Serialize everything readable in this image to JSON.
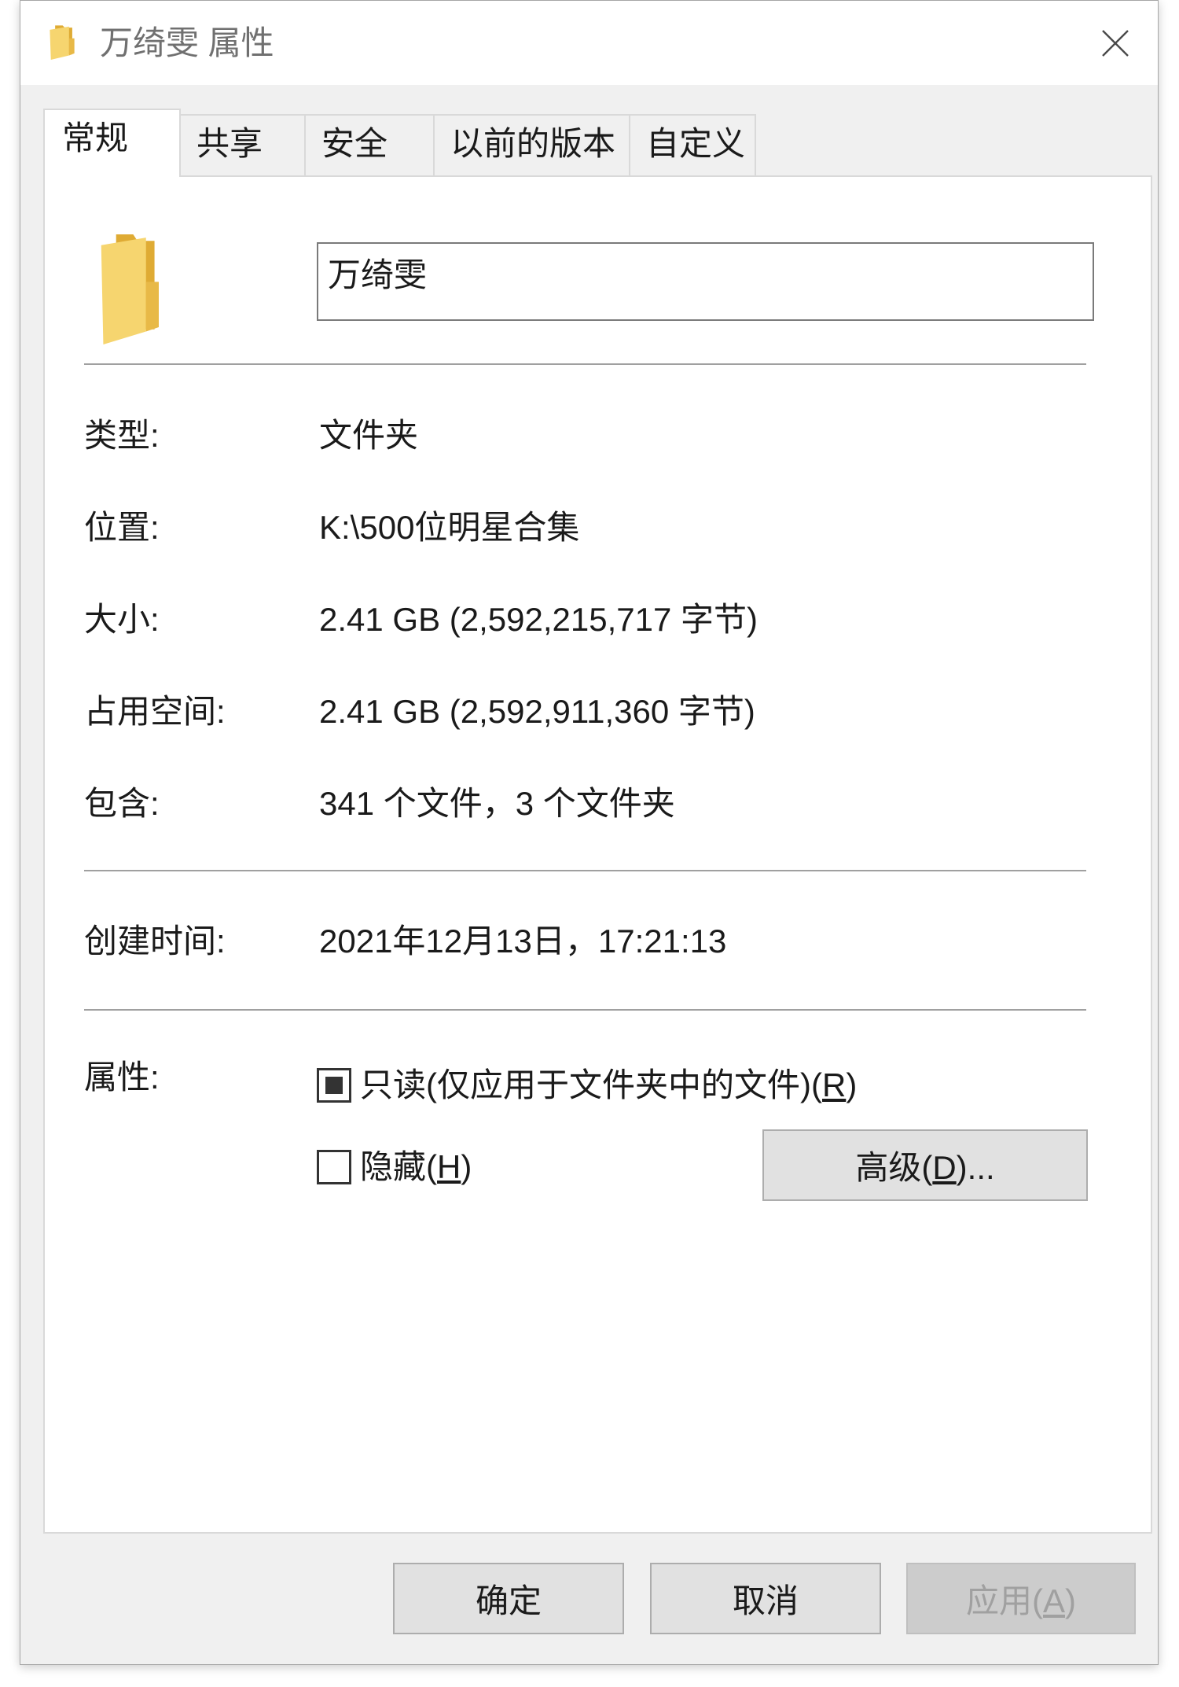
{
  "window": {
    "title": "万绮雯 属性",
    "icon": "folder-icon",
    "close_icon": "close-icon"
  },
  "tabs": [
    {
      "label": "常规",
      "selected": true
    },
    {
      "label": "共享",
      "selected": false
    },
    {
      "label": "安全",
      "selected": false
    },
    {
      "label": "以前的版本",
      "selected": false
    },
    {
      "label": "自定义",
      "selected": false
    }
  ],
  "general": {
    "icon": "folder-icon",
    "name": "万绮雯",
    "details": [
      {
        "label": "类型:",
        "value": "文件夹"
      },
      {
        "label": "位置:",
        "value": "K:\\500位明星合集"
      },
      {
        "label": "大小:",
        "value": "2.41 GB (2,592,215,717 字节)"
      },
      {
        "label": "占用空间:",
        "value": "2.41 GB (2,592,911,360 字节)"
      },
      {
        "label": "包含:",
        "value": "341 个文件，3 个文件夹"
      }
    ],
    "created": {
      "label": "创建时间:",
      "value": "2021年12月13日，17:21:13"
    },
    "attributes": {
      "label": "属性:",
      "readonly": {
        "label": "只读(仅应用于文件夹中的文件)(R)",
        "checked": true,
        "indeterminate": true
      },
      "hidden": {
        "label": "隐藏(H)",
        "checked": false,
        "indeterminate": false
      },
      "advanced_button": {
        "label": "高级(D)..."
      }
    }
  },
  "buttons": {
    "ok": {
      "label": "确定",
      "disabled": false
    },
    "cancel": {
      "label": "取消",
      "disabled": false
    },
    "apply": {
      "label": "应用(A)",
      "disabled": true
    }
  },
  "colors": {
    "dialog_bg": "#f0f0f0",
    "panel_bg": "#ffffff",
    "panel_border": "#d9d9d9",
    "window_border": "#a6a6a6",
    "separator": "#a0a0a0",
    "input_border": "#7a7a7a",
    "text": "#1a1a1a",
    "title_text": "#707070",
    "button_bg": "#e1e1e1",
    "button_border": "#adadad",
    "disabled_bg": "#cccccc",
    "disabled_border": "#bfbfbf",
    "disabled_text": "#a0a0a0",
    "checkbox_border": "#333333",
    "folder_front": "#f6d56f",
    "folder_back": "#dfab34",
    "folder_side": "#e8b947"
  }
}
